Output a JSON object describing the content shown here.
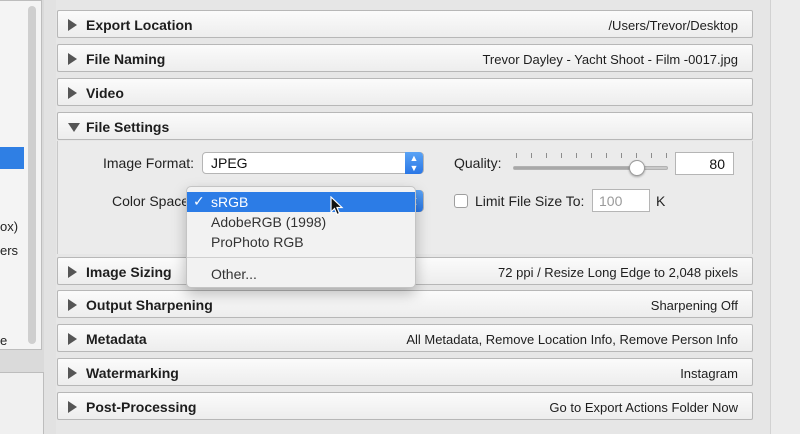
{
  "left_panel": {
    "texts": [
      "ox)",
      "ers",
      "e"
    ]
  },
  "sections": {
    "export_location": {
      "title": "Export Location",
      "summary": "/Users/Trevor/Desktop"
    },
    "file_naming": {
      "title": "File Naming",
      "summary": "Trevor Dayley - Yacht Shoot - Film -0017.jpg"
    },
    "video": {
      "title": "Video",
      "summary": ""
    },
    "file_settings": {
      "title": "File Settings"
    },
    "image_sizing": {
      "title": "Image Sizing",
      "summary": "72 ppi / Resize Long Edge to 2,048 pixels"
    },
    "output_sharpening": {
      "title": "Output Sharpening",
      "summary": "Sharpening Off"
    },
    "metadata": {
      "title": "Metadata",
      "summary": "All Metadata, Remove Location Info, Remove Person Info"
    },
    "watermarking": {
      "title": "Watermarking",
      "summary": "Instagram"
    },
    "post_processing": {
      "title": "Post-Processing",
      "summary": "Go to Export Actions Folder Now"
    }
  },
  "file_settings": {
    "image_format_label": "Image Format:",
    "image_format_value": "JPEG",
    "color_space_label": "Color Space:",
    "quality_label": "Quality:",
    "quality_value": "80",
    "limit_label": "Limit File Size To:",
    "limit_value": "100",
    "limit_unit": "K",
    "limit_checked": false
  },
  "color_space_menu": {
    "items": [
      "sRGB",
      "AdobeRGB (1998)",
      "ProPhoto RGB",
      "Other..."
    ],
    "selected": "sRGB",
    "check": "✓"
  },
  "colors": {
    "selection_blue": "#2c7ce6"
  }
}
